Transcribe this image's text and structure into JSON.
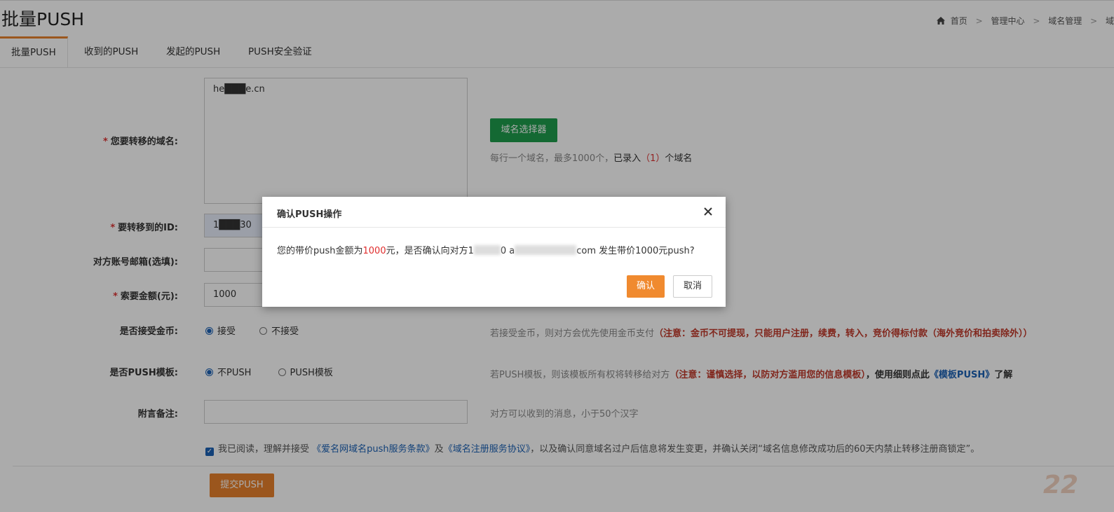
{
  "page": {
    "title": "批量PUSH"
  },
  "breadcrumb": {
    "home": "首页",
    "items": [
      "管理中心",
      "域名管理",
      "域"
    ]
  },
  "tabs": [
    "批量PUSH",
    "收到的PUSH",
    "发起的PUSH",
    "PUSH安全验证"
  ],
  "form": {
    "domain_label": "您要转移的域名:",
    "domain_value": "he███e.cn",
    "domain_selector_button": "域名选择器",
    "domain_hint_prefix": "每行一个域名，最多1000个，",
    "domain_hint_count_label": "已录入",
    "domain_count": "（1）",
    "domain_hint_suffix": "个域名",
    "target_id_label": "要转移到的ID:",
    "target_id_value": "1███30",
    "email_label": "对方账号邮箱(选填):",
    "amount_label": "索要金额(元):",
    "amount_value": "1000",
    "coin_label": "是否接受金币:",
    "coin_accept": "接受",
    "coin_reject": "不接受",
    "coin_hint": "若接受金币，则对方会优先使用金币支付",
    "coin_warn": "（注意：金币不可提现，只能用户注册，续费，转入，竞价得标付款（海外竞价和拍卖除外））",
    "template_label": "是否PUSH模板:",
    "template_no": "不PUSH",
    "template_yes": "PUSH模板",
    "template_hint": "若PUSH模板，则该模板所有权将转移给对方",
    "template_warn": "（注意：谨慎选择，以防对方滥用您的信息模板）",
    "template_hint2": "，使用细则点此",
    "template_link": "《模板PUSH》",
    "template_hint3": "了解",
    "remark_label": "附言备注:",
    "remark_hint": "对方可以收到的消息，小于50个汉字",
    "agree_prefix": "我已阅读，理解并接受",
    "agree_link1": "《爱名网域名push服务条款》",
    "agree_and": "及",
    "agree_link2": "《域名注册服务协议》",
    "agree_suffix": "，以及确认同意域名过户后信息将发生变更，并确认关闭“域名信息修改成功后的60天内禁止转移注册商锁定”。",
    "submit_button": "提交PUSH"
  },
  "modal": {
    "title": "确认PUSH操作",
    "msg_prefix": "您的带价push金额为",
    "msg_amount": "1000",
    "msg_mid": "元，是否确认向对方1",
    "msg_mid2": "0 a",
    "msg_suffix": "com 发生带价1000元push?",
    "confirm_button": "确认",
    "cancel_button": "取消"
  },
  "watermark": "22",
  "colors": {
    "orange": "#e8802c",
    "green": "#1e9d4c",
    "link": "#1b61b5",
    "warn": "#c0392b"
  }
}
